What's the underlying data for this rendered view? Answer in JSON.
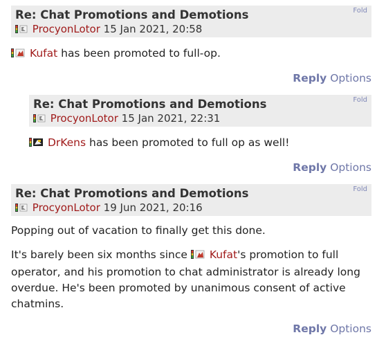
{
  "colors": {
    "header_bg": "#ececec",
    "username": "#a01b1b",
    "action": "#6f77a8",
    "fold": "#8088b8"
  },
  "posts": [
    {
      "title": "Re: Chat Promotions and Demotions",
      "fold": "Fold",
      "author": "ProcyonLotor",
      "date": "15 Jan 2021, 20:58",
      "body_user": "Kufat",
      "body_text": " has been promoted to full-op.",
      "reply": "Reply",
      "options": "Options"
    },
    {
      "title": "Re: Chat Promotions and Demotions",
      "fold": "Fold",
      "author": "ProcyonLotor",
      "date": "15 Jan 2021, 22:31",
      "body_user": "DrKens",
      "body_text": " has been promoted to full op as well!",
      "reply": "Reply",
      "options": "Options"
    },
    {
      "title": "Re: Chat Promotions and Demotions",
      "fold": "Fold",
      "author": "ProcyonLotor",
      "date": "19 Jun 2021, 20:16",
      "para1": "Popping out of vacation to finally get this done.",
      "para2_pre": "It's barely been six months since ",
      "para2_user": "Kufat",
      "para2_post": "'s promotion to full operator, and his promotion to chat administrator is already long overdue. He's been promoted by unanimous consent of active chatmins.",
      "reply": "Reply",
      "options": "Options"
    }
  ]
}
